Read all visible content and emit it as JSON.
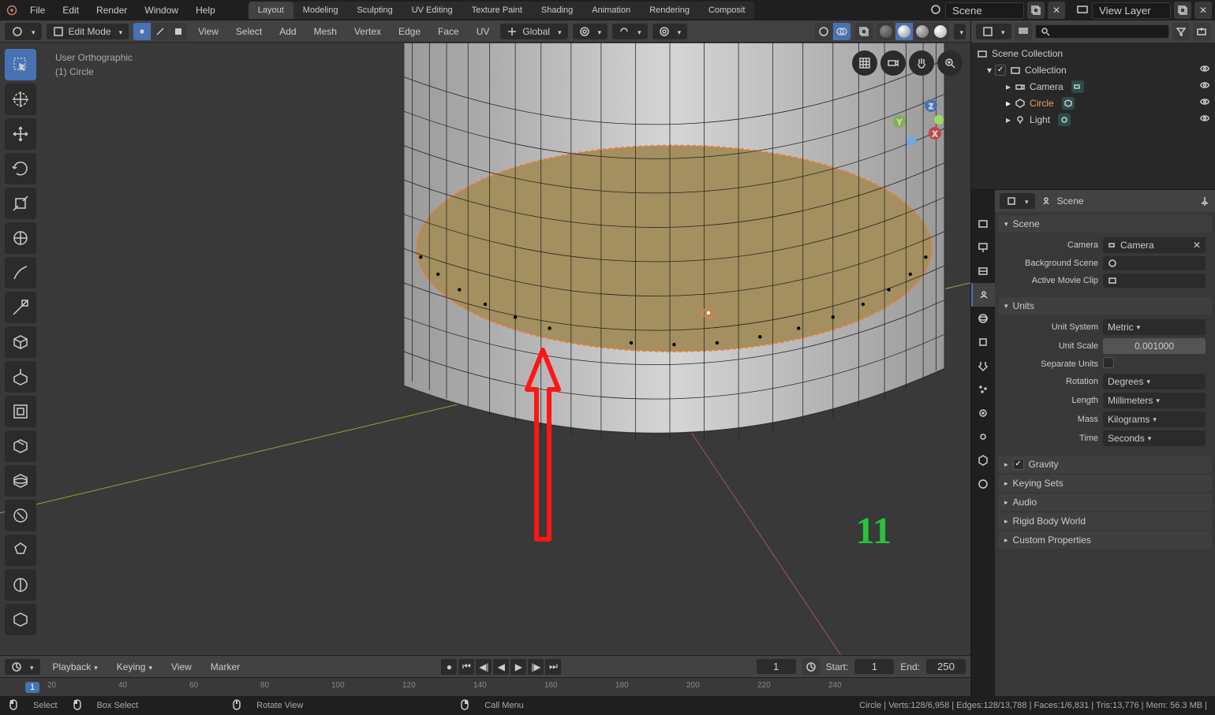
{
  "topbar": {
    "menus": [
      "File",
      "Edit",
      "Render",
      "Window",
      "Help"
    ],
    "workspaces": [
      "Layout",
      "Modeling",
      "Sculpting",
      "UV Editing",
      "Texture Paint",
      "Shading",
      "Animation",
      "Rendering",
      "Composit"
    ],
    "active_workspace": "Layout",
    "scene_label": "Scene",
    "viewlayer_label": "View Layer"
  },
  "vp_header": {
    "mode": "Edit Mode",
    "menus": [
      "View",
      "Select",
      "Add",
      "Mesh",
      "Vertex",
      "Edge",
      "Face",
      "UV"
    ],
    "orientation": "Global"
  },
  "vp_overlay": {
    "line1": "User Orthographic",
    "line2": "(1) Circle"
  },
  "annotation_number": "11",
  "timeline": {
    "menus": [
      "Playback",
      "Keying",
      "View",
      "Marker"
    ],
    "current": "1",
    "start_label": "Start:",
    "start": "1",
    "end_label": "End:",
    "end": "250",
    "marks": [
      20,
      40,
      60,
      80,
      100,
      120,
      140,
      160,
      180,
      200,
      220,
      240
    ]
  },
  "statusbar": {
    "select": "Select",
    "boxselect": "Box Select",
    "rotate": "Rotate View",
    "callmenu": "Call Menu",
    "stats": "Circle | Verts:128/6,958 | Edges:128/13,788 | Faces:1/6,831 | Tris:13,776 | Mem: 56.3 MB |"
  },
  "outliner": {
    "root": "Scene Collection",
    "collection": "Collection",
    "items": [
      {
        "name": "Camera",
        "icon": "camera"
      },
      {
        "name": "Circle",
        "icon": "mesh",
        "selected": true
      },
      {
        "name": "Light",
        "icon": "light"
      }
    ]
  },
  "properties": {
    "breadcrumb": "Scene",
    "scene_panel": "Scene",
    "camera_label": "Camera",
    "camera_value": "Camera",
    "bgscene_label": "Background Scene",
    "clip_label": "Active Movie Clip",
    "units_panel": "Units",
    "unit_system_label": "Unit System",
    "unit_system": "Metric",
    "unit_scale_label": "Unit Scale",
    "unit_scale": "0.001000",
    "sep_units_label": "Separate Units",
    "rotation_label": "Rotation",
    "rotation": "Degrees",
    "length_label": "Length",
    "length": "Millimeters",
    "mass_label": "Mass",
    "mass": "Kilograms",
    "time_label": "Time",
    "time": "Seconds",
    "gravity_panel": "Gravity",
    "keying_panel": "Keying Sets",
    "audio_panel": "Audio",
    "rigid_panel": "Rigid Body World",
    "custom_panel": "Custom Properties"
  },
  "chart_data": {
    "type": "table",
    "note": "3D viewport scene — not a chart"
  }
}
